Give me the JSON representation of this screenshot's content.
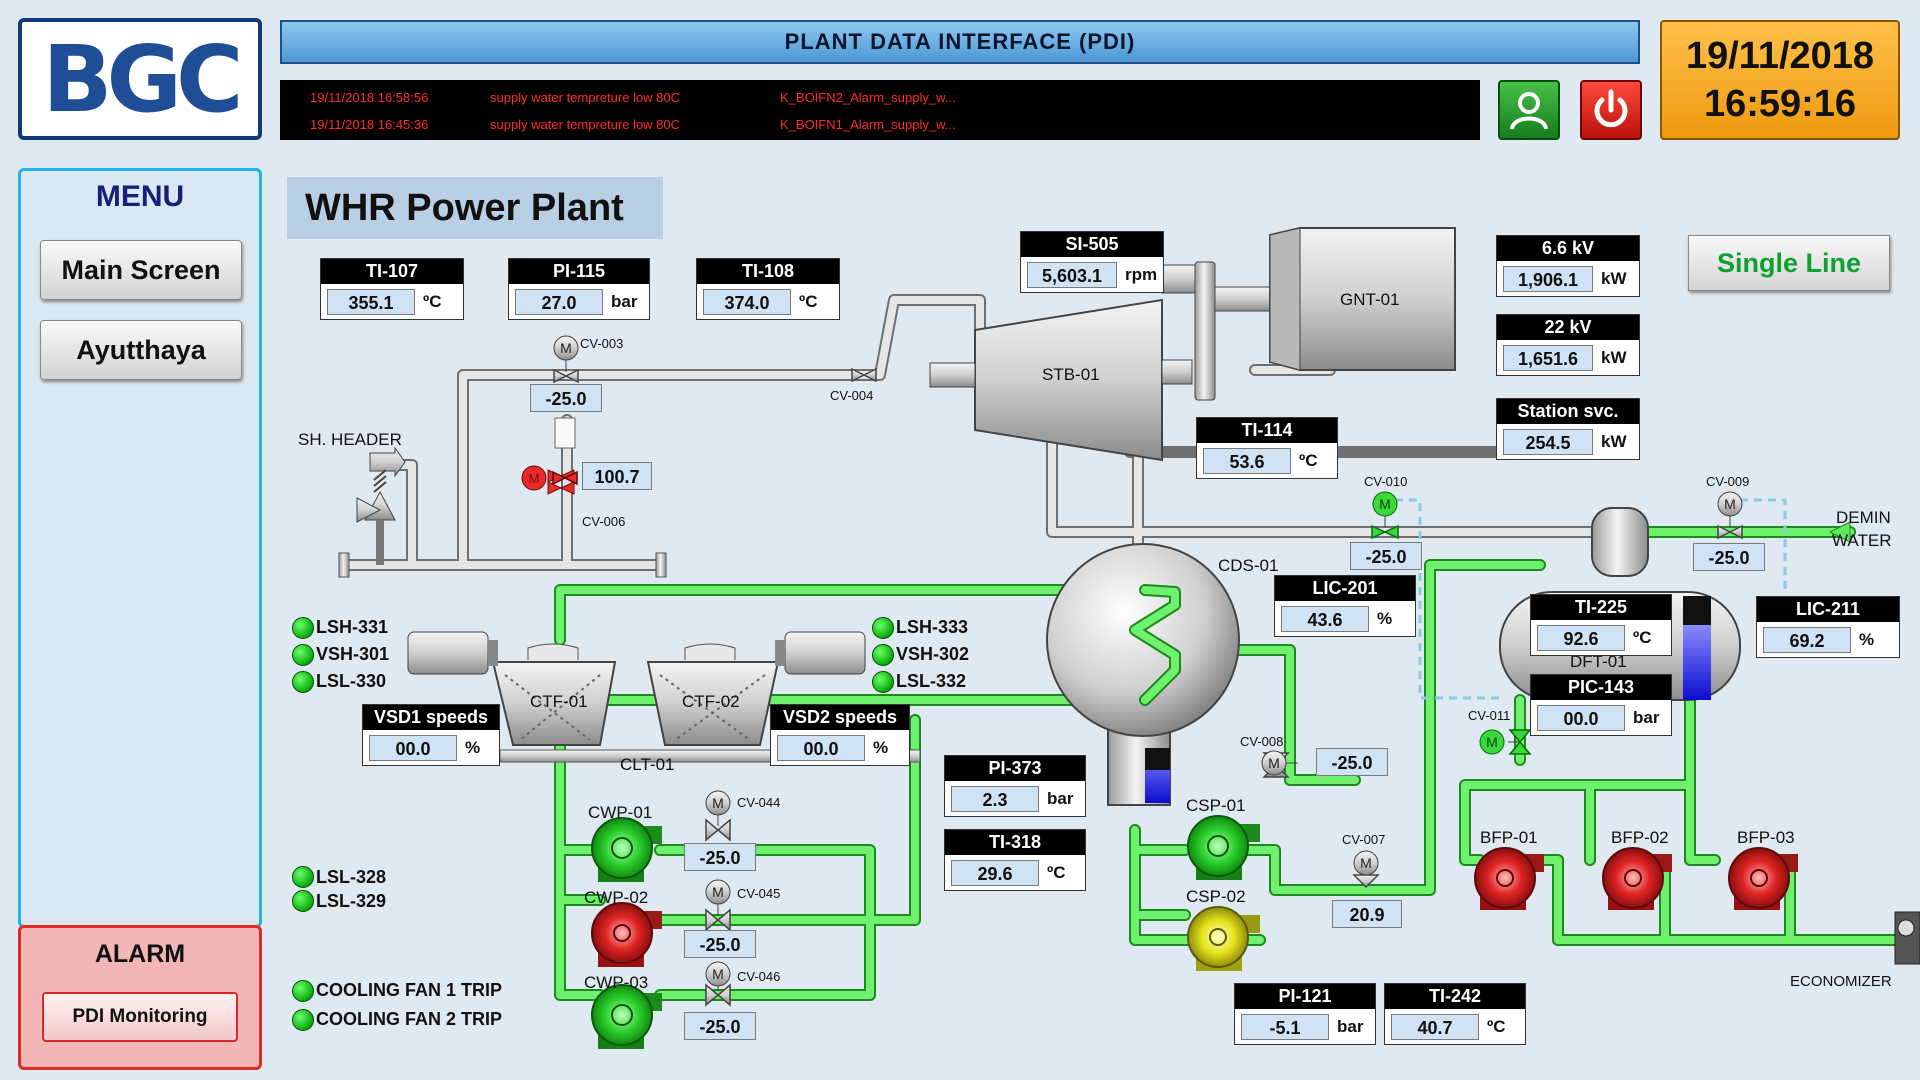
{
  "header": {
    "logo": "BGC",
    "title": "PLANT DATA INTERFACE (PDI)",
    "alarms": [
      {
        "time": "19/11/2018 16:58:56",
        "message": "supply water tempreture low 80C",
        "tag": "K_BOIFN2_Alarm_supply_w..."
      },
      {
        "time": "19/11/2018 16:45:36",
        "message": "supply water tempreture low 80C",
        "tag": "K_BOIFN1_Alarm_supply_w..."
      }
    ],
    "user_icon": "user-icon",
    "power_icon": "power-icon",
    "date": "19/11/2018",
    "time": "16:59:16"
  },
  "menu": {
    "title": "MENU",
    "items": [
      {
        "label": "Main Screen"
      },
      {
        "label": "Ayutthaya"
      }
    ],
    "alarm_title": "ALARM",
    "alarm_button": "PDI Monitoring"
  },
  "plant": {
    "title": "WHR Power Plant",
    "single_line": "Single Line"
  },
  "instruments": {
    "ti107": {
      "tag": "TI-107",
      "value": "355.1",
      "unit": "ºC"
    },
    "pi115": {
      "tag": "PI-115",
      "value": "27.0",
      "unit": "bar"
    },
    "ti108": {
      "tag": "TI-108",
      "value": "374.0",
      "unit": "ºC"
    },
    "si505": {
      "tag": "SI-505",
      "value": "5,603.1",
      "unit": "rpm"
    },
    "kv66": {
      "tag": "6.6 kV",
      "value": "1,906.1",
      "unit": "kW"
    },
    "kv22": {
      "tag": "22 kV",
      "value": "1,651.6",
      "unit": "kW"
    },
    "station": {
      "tag": "Station svc.",
      "value": "254.5",
      "unit": "kW"
    },
    "ti114": {
      "tag": "TI-114",
      "value": "53.6",
      "unit": "ºC"
    },
    "lic201": {
      "tag": "LIC-201",
      "value": "43.6",
      "unit": "%"
    },
    "ti225": {
      "tag": "TI-225",
      "value": "92.6",
      "unit": "ºC"
    },
    "pic143": {
      "tag": "PIC-143",
      "value": "00.0",
      "unit": "bar"
    },
    "lic211": {
      "tag": "LIC-211",
      "value": "69.2",
      "unit": "%"
    },
    "vsd1": {
      "tag": "VSD1 speeds",
      "value": "00.0",
      "unit": "%"
    },
    "vsd2": {
      "tag": "VSD2 speeds",
      "value": "00.0",
      "unit": "%"
    },
    "pi373": {
      "tag": "PI-373",
      "value": "2.3",
      "unit": "bar"
    },
    "ti318": {
      "tag": "TI-318",
      "value": "29.6",
      "unit": "ºC"
    },
    "pi121": {
      "tag": "PI-121",
      "value": "-5.1",
      "unit": "bar"
    },
    "ti242": {
      "tag": "TI-242",
      "value": "40.7",
      "unit": "ºC"
    }
  },
  "valves": {
    "cv003": {
      "tag": "CV-003",
      "value": "-25.0"
    },
    "cv004": {
      "tag": "CV-004"
    },
    "cv006": {
      "tag": "CV-006",
      "value": "100.7"
    },
    "cv010": {
      "tag": "CV-010",
      "value": "-25.0"
    },
    "cv009": {
      "tag": "CV-009",
      "value": "-25.0"
    },
    "cv011": {
      "tag": "CV-011"
    },
    "cv008": {
      "tag": "CV-008",
      "value": "-25.0"
    },
    "cv007": {
      "tag": "CV-007",
      "value": "20.9"
    },
    "cv044": {
      "tag": "CV-044",
      "value": "-25.0"
    },
    "cv045": {
      "tag": "CV-045",
      "value": "-25.0"
    },
    "cv046": {
      "tag": "CV-046",
      "value": "-25.0"
    }
  },
  "equipment": {
    "sh_header": "SH. HEADER",
    "stb": "STB-01",
    "gnt": "GNT-01",
    "cds": "CDS-01",
    "dft": "DFT-01",
    "ctf1": "CTF-01",
    "ctf2": "CTF-02",
    "clt": "CLT-01",
    "cwp1": "CWP-01",
    "cwp2": "CWP-02",
    "cwp3": "CWP-03",
    "csp1": "CSP-01",
    "csp2": "CSP-02",
    "bfp1": "BFP-01",
    "bfp2": "BFP-02",
    "bfp3": "BFP-03",
    "demin": "DEMIN",
    "water": "WATER",
    "economizer": "ECONOMIZER",
    "motor_symbol": "M"
  },
  "status_left": [
    {
      "label": "LSH-331"
    },
    {
      "label": "VSH-301"
    },
    {
      "label": "LSL-330"
    }
  ],
  "status_right": [
    {
      "label": "LSH-333"
    },
    {
      "label": "VSH-302"
    },
    {
      "label": "LSL-332"
    }
  ],
  "status_lsl": [
    {
      "label": "LSL-328"
    },
    {
      "label": "LSL-329"
    }
  ],
  "status_trip": [
    {
      "label": "COOLING FAN  1 TRIP"
    },
    {
      "label": "COOLING FAN 2 TRIP"
    }
  ],
  "colors": {
    "pump_running": "#2ed22e",
    "pump_stopped": "#e02424",
    "pump_standby": "#e6e21a",
    "water_pipe": "#5fe85f",
    "steam_pipe": "#c8c8c8"
  }
}
